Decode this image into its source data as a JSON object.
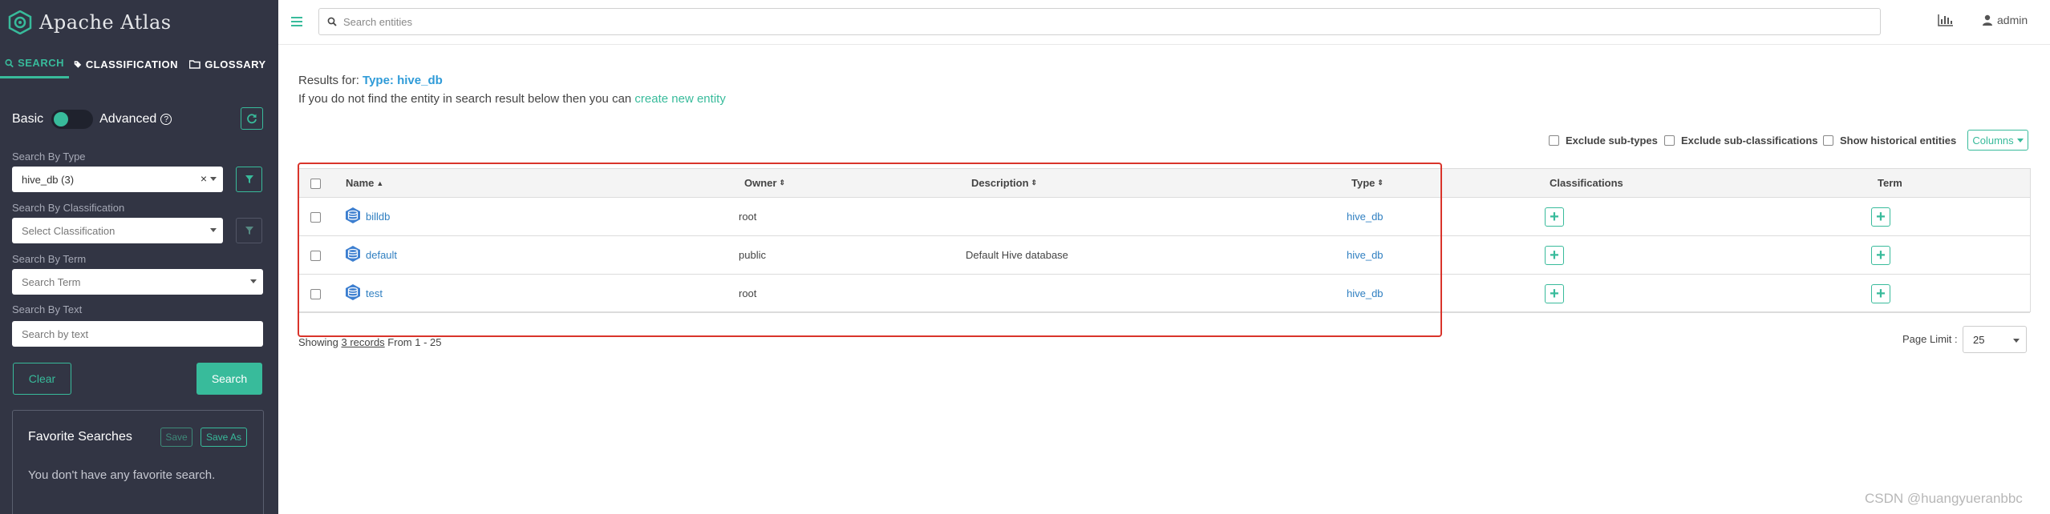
{
  "app": {
    "title": "Apache Atlas"
  },
  "sidebar": {
    "tabs": [
      {
        "label": "SEARCH",
        "icon": "search-icon",
        "active": true
      },
      {
        "label": "CLASSIFICATION",
        "icon": "tag-icon",
        "active": false
      },
      {
        "label": "GLOSSARY",
        "icon": "folder-icon",
        "active": false
      }
    ],
    "mode_basic": "Basic",
    "mode_advanced": "Advanced",
    "search_by_type_label": "Search By Type",
    "search_by_type_value": "hive_db (3)",
    "search_by_classification_label": "Search By Classification",
    "search_by_classification_placeholder": "Select Classification",
    "search_by_term_label": "Search By Term",
    "search_by_term_placeholder": "Search Term",
    "search_by_text_label": "Search By Text",
    "search_by_text_placeholder": "Search by text",
    "clear_label": "Clear",
    "search_label": "Search",
    "favorites": {
      "title": "Favorite Searches",
      "save_label": "Save",
      "save_as_label": "Save As",
      "empty_text": "You don't have any favorite search."
    }
  },
  "topbar": {
    "search_placeholder": "Search entities",
    "user": "admin"
  },
  "results": {
    "prefix": "Results for: ",
    "type_text": "Type: hive_db",
    "hint_text": "If you do not find the entity in search result below then you can ",
    "hint_link": "create new entity"
  },
  "options": {
    "exclude_subtypes": "Exclude sub-types",
    "exclude_subclassifications": "Exclude sub-classifications",
    "show_historical": "Show historical entities",
    "columns_label": "Columns"
  },
  "table": {
    "headers": {
      "name": "Name",
      "owner": "Owner",
      "description": "Description",
      "type": "Type",
      "classifications": "Classifications",
      "term": "Term"
    },
    "rows": [
      {
        "name": "billdb",
        "owner": "root",
        "description": "",
        "type": "hive_db"
      },
      {
        "name": "default",
        "owner": "public",
        "description": "Default Hive database",
        "type": "hive_db"
      },
      {
        "name": "test",
        "owner": "root",
        "description": "",
        "type": "hive_db"
      }
    ]
  },
  "footer": {
    "showing_prefix": "Showing ",
    "records": "3 records",
    "range": " From 1 - 25",
    "page_limit_label": "Page Limit :",
    "page_limit_value": "25"
  },
  "watermark": "CSDN @huangyueranbbc",
  "colors": {
    "accent": "#38bb9b",
    "sidebar": "#323544",
    "link": "#2f7fc1",
    "highlight": "#d9342b"
  }
}
